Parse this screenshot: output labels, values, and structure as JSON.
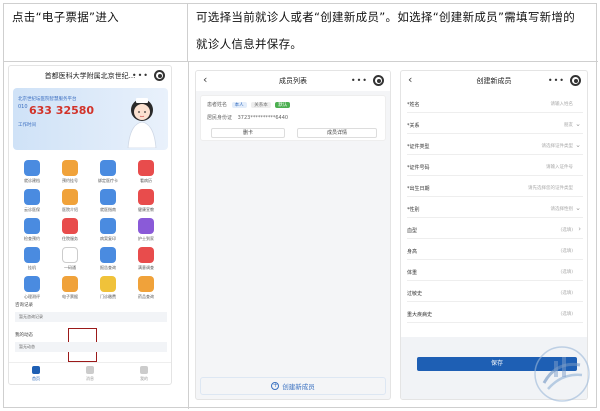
{
  "header": {
    "left": "点击“电子票据”进入",
    "right_line1": "可选择当前就诊人或者“创建新成员”。如选择“创建新成员”需填写新增的",
    "right_line2": "就诊人信息并保存。"
  },
  "phone1": {
    "title": "首都医科大学附属北京世纪...",
    "banner_line1": "北京世纪坛医院智慧服务平台",
    "banner_phone": "633 32580",
    "banner_phone_prefix": "010",
    "banner_line2": "工作时间",
    "grid": [
      {
        "label": "就诊建档",
        "color": "#4a8be0"
      },
      {
        "label": "预约挂号",
        "color": "#f0a23a"
      },
      {
        "label": "绑定医疗卡",
        "color": "#4a8be0"
      },
      {
        "label": "看病历",
        "color": "#e84c4c"
      },
      {
        "label": "云诊医保",
        "color": "#4a8be0"
      },
      {
        "label": "医院介绍",
        "color": "#f0a23a"
      },
      {
        "label": "就医指南",
        "color": "#4a8be0"
      },
      {
        "label": "健康宣教",
        "color": "#e84c4c"
      },
      {
        "label": "检查预约",
        "color": "#4a8be0"
      },
      {
        "label": "住院服务",
        "color": "#e84c4c"
      },
      {
        "label": "病案复印",
        "color": "#4a8be0"
      },
      {
        "label": "护士到家",
        "color": "#8a5ad8"
      },
      {
        "label": "挂机",
        "color": "#4a8be0"
      },
      {
        "label": "一码通",
        "color": "#ffffff"
      },
      {
        "label": "报告查询",
        "color": "#4a8be0"
      },
      {
        "label": "满意调查",
        "color": "#e84c4c"
      },
      {
        "label": "心理测评",
        "color": "#4a8be0"
      },
      {
        "label": "电子票据",
        "color": "#f0a23a"
      },
      {
        "label": "门诊缴费",
        "color": "#f0c23a"
      },
      {
        "label": "药品查询",
        "color": "#f0a23a"
      }
    ],
    "section1": "咨询记录",
    "section1_empty": "暂无咨询记录",
    "section2": "我的动态",
    "section2_empty": "暂无动态",
    "tabs": [
      {
        "label": "首页"
      },
      {
        "label": "消息"
      },
      {
        "label": "我的"
      }
    ]
  },
  "phone2": {
    "title": "成员列表",
    "name_label": "患者姓名",
    "tag1": "本人",
    "tag2": "关系本",
    "tag3": "默认",
    "id_label": "居民身份证",
    "id_value": "3723**********6440",
    "btn1": "删卡",
    "btn2": "成员详情",
    "add": "创建新成员"
  },
  "phone3": {
    "title": "创建新成员",
    "fields": [
      {
        "label": "*姓名",
        "value": "请输入姓名",
        "arrow": ""
      },
      {
        "label": "*关系",
        "value": "朋友",
        "arrow": "⌄"
      },
      {
        "label": "*证件类型",
        "value": "请选择证件类型",
        "arrow": "⌄"
      },
      {
        "label": "*证件号码",
        "value": "请输入证件号",
        "arrow": ""
      },
      {
        "label": "*出生日期",
        "value": "请先选择您的证件类型",
        "arrow": ""
      },
      {
        "label": "*性别",
        "value": "请选择性别",
        "arrow": "⌄"
      },
      {
        "label": "血型",
        "value": "(选填)",
        "arrow": "›"
      },
      {
        "label": "身高",
        "value": "(选填)",
        "arrow": ""
      },
      {
        "label": "体重",
        "value": "(选填)",
        "arrow": ""
      },
      {
        "label": "过敏史",
        "value": "(选填)",
        "arrow": ""
      },
      {
        "label": "重大疾病史",
        "value": "(选填)",
        "arrow": ""
      }
    ],
    "save": "保存"
  }
}
